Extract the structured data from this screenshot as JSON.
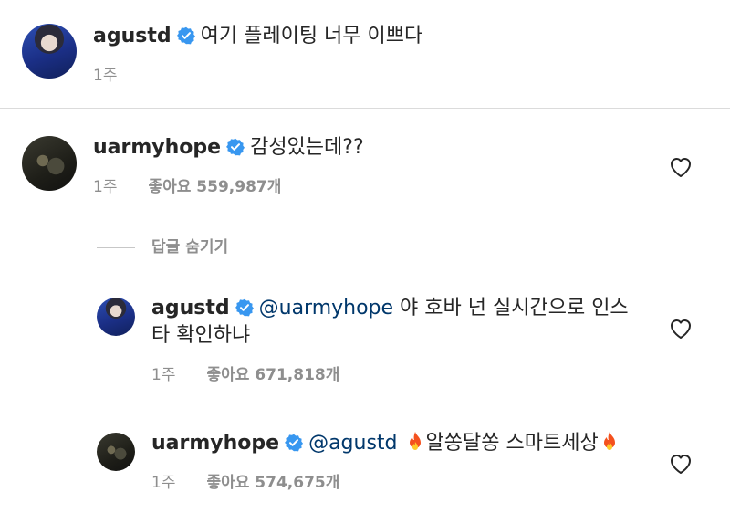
{
  "caption": {
    "username": "agustd",
    "text": "여기 플레이팅 너무 이쁘다",
    "time": "1주"
  },
  "comments": [
    {
      "username": "uarmyhope",
      "text": "감성있는데??",
      "time": "1주",
      "likes": "좋아요 559,987개"
    }
  ],
  "hide_replies_label": "답글 숨기기",
  "replies": [
    {
      "username": "agustd",
      "mention": "@uarmyhope",
      "text_line1": " 야 호바 넌 실시간으로 인스",
      "text_line2": "타 확인하냐",
      "time": "1주",
      "likes": "좋아요 671,818개"
    },
    {
      "username": "uarmyhope",
      "mention": "@agustd",
      "text": "알쏭달쏭 스마트세상",
      "time": "1주",
      "likes": "좋아요 574,675개"
    }
  ],
  "colors": {
    "verified": "#3897f0",
    "mention": "#00376b",
    "meta": "#8e8e8e",
    "fire": "#f4511e"
  },
  "icons": {
    "verified": "verified-badge-icon",
    "like": "heart-outline-icon",
    "fire": "fire-emoji-icon"
  }
}
